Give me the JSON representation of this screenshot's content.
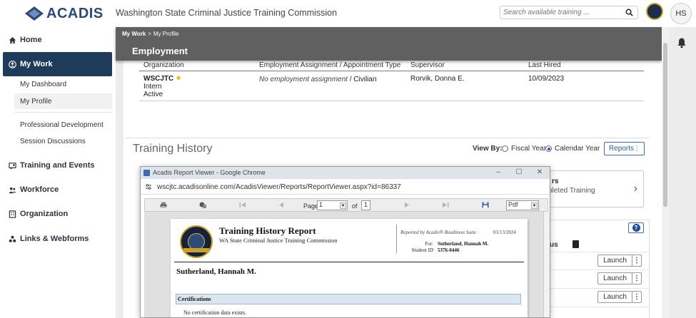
{
  "header": {
    "logo_text": "ACADIS",
    "org_name": "Washington State Criminal Justice Training Commission",
    "search_placeholder": "Search available training ...",
    "user_initials": "HS"
  },
  "sidebar": {
    "items": [
      {
        "label": "Home",
        "icon": "home-icon"
      },
      {
        "label": "My Work",
        "icon": "user-circle-icon",
        "active": true
      },
      {
        "label": "Training and Events",
        "icon": "training-icon"
      },
      {
        "label": "Workforce",
        "icon": "users-icon"
      },
      {
        "label": "Organization",
        "icon": "building-icon"
      },
      {
        "label": "Links & Webforms",
        "icon": "links-icon"
      }
    ],
    "sub_items": [
      "My Dashboard",
      "My Profile",
      "Professional Development",
      "Session Discussions"
    ]
  },
  "breadcrumb": {
    "parent": "My Work",
    "separator": ">",
    "current": "My Profile"
  },
  "employment": {
    "title": "Employment",
    "columns": [
      "Organization",
      "Employment Assignment / Appointment Type",
      "Supervisor",
      "Last Hired"
    ],
    "row": {
      "org": "WSCJTC",
      "org_line2": "Intern",
      "org_line3": "Active",
      "assignment": "No employment assignment",
      "appointment_type": " / Civilian",
      "supervisor": "Rorvik, Donna E.",
      "last_hired": "10/09/2023"
    }
  },
  "training_history": {
    "title": "Training History",
    "view_by_label": "View By:",
    "options": [
      "Fiscal Year",
      "Calendar Year"
    ],
    "selected": "Calendar Year",
    "reports_label": "Reports",
    "card_title": "rs",
    "card_subtitle": "pleted Training",
    "status_col": "us",
    "launch_label": "Launch",
    "launch_rows": 3
  },
  "popup": {
    "window_title": "Acadis Report Viewer - Google Chrome",
    "url": "wscjtc.acadisonline.com/AcadisViewer/Reports/ReportViewer.aspx?id=86337",
    "page_label": "Page",
    "page_value": "1",
    "of_label": "of",
    "page_total": "1",
    "format": "Pdf",
    "report": {
      "title": "Training History Report",
      "subtitle": "WA State Criminal Justice Training Commission",
      "reported_by": "Reported by Acadis® Readiness Suite",
      "date": "03/13/2024",
      "for_label": "For:",
      "for_value": "Sutherland, Hannah M.",
      "student_id_label": "Student ID",
      "student_id_value": "5376-0446",
      "student_name": "Sutherland, Hannah M.",
      "section": "Certifications",
      "no_data": "No certification data exists."
    }
  },
  "colors": {
    "sidebar_active": "#1f3b5a",
    "breadcrumb_bar": "#606060",
    "accent": "#2d5a9e"
  }
}
